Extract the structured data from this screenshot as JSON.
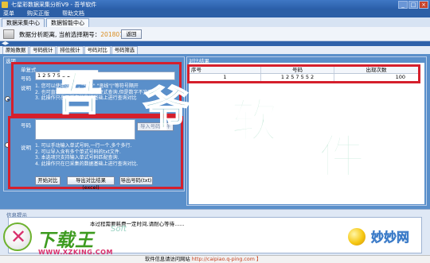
{
  "window": {
    "title": "七星彩数据采集分析V9 - 吾爷软件",
    "buttons": [
      "_",
      "□",
      "×"
    ]
  },
  "menu": [
    "菜单",
    "购买正版",
    "帮助文档"
  ],
  "top_tabs": [
    {
      "label": "数据采集中心",
      "active": false
    },
    {
      "label": "数据智能中心",
      "active": true
    }
  ],
  "toolbar": {
    "label_prefix": "数据分析距离, 当前选择期号：",
    "issue": "2018016",
    "return_label": "返回"
  },
  "sub_tabs": [
    {
      "label": "原始数据",
      "active": false
    },
    {
      "label": "号码统计",
      "active": false
    },
    {
      "label": "排位统计",
      "active": false
    },
    {
      "label": "号码对比",
      "active": true
    },
    {
      "label": "号码筛选",
      "active": false
    }
  ],
  "left_panel": {
    "group_title": "选项",
    "single_group": {
      "title": "单复式",
      "number_label": "号码",
      "number_value": "1 2 5 7 5 5 2",
      "desc_label": "说明",
      "desc_lines": [
        "1. 您可以使用逗号\" , \"空格\" \"竖线\"|\"等符号隔开",
        "2. 也可直接输入多个数字进行复式查询,但是数字不宜重复",
        "3. 此操作只在已采集的数据基础上进行查询对比"
      ]
    },
    "import_group": {
      "number_label": "号码",
      "import_button": "导入号码文件",
      "desc_label": "说明",
      "desc_lines": [
        "1. 可以手动输入单式号码,一行一个,多个多行.",
        "2. 可以导入含有多个单式号码的txt文件.",
        "3. 本选项只支持输入单式号码匹配查询.",
        "4. 此操作只在已采集的数据基础上进行查询对比."
      ]
    },
    "buttons": {
      "start": "开始对比",
      "export_excel": "导出对比结果(excel)",
      "export_txt": "导出号码(txt)"
    }
  },
  "right_panel": {
    "group_title": "对比结果",
    "columns": [
      "序号",
      "号码",
      "出现次数"
    ],
    "rows": [
      {
        "index": "1",
        "number": "1 2 5 7 5 5 2",
        "count": "100"
      }
    ]
  },
  "bottom": {
    "title": "信息提示",
    "log": "本过程需要耗费一定时间,请耐心等待......",
    "status_prefix": "软件信息请访问网站",
    "status_link": "http://caipiao.q-ping.com",
    "status_suffix": "】"
  },
  "watermark": [
    "吾",
    "爷",
    "软",
    "件"
  ],
  "logos": {
    "left_name": "下载王",
    "left_soft": "Soft",
    "left_url": "WWW.XZKING.COM",
    "right_name": "妙妙网",
    "right_pinyin": "MIAOMIAOWANG"
  },
  "colors": {
    "highlight_border": "#d51f2c",
    "panel_bg": "#5a8fca",
    "issue_number": "#d98a1a"
  }
}
